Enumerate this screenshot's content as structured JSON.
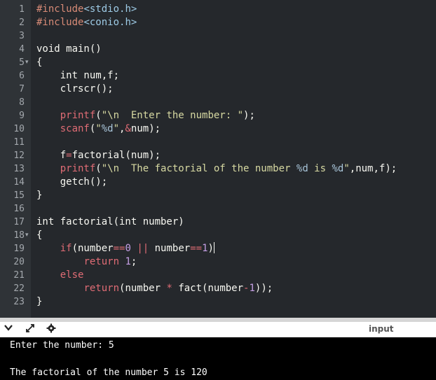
{
  "editor": {
    "lines": [
      {
        "n": "1",
        "fold": "",
        "t": [
          [
            "pp",
            "#include"
          ],
          [
            "hdr",
            "<stdio.h>"
          ]
        ]
      },
      {
        "n": "2",
        "fold": "",
        "t": [
          [
            "pp",
            "#include"
          ],
          [
            "hdr",
            "<conio.h>"
          ]
        ]
      },
      {
        "n": "3",
        "fold": "",
        "t": []
      },
      {
        "n": "4",
        "fold": "",
        "t": [
          [
            "kw",
            "void main()"
          ]
        ]
      },
      {
        "n": "5",
        "fold": "▾",
        "t": [
          [
            "kw",
            "{"
          ]
        ]
      },
      {
        "n": "6",
        "fold": "",
        "t": [
          [
            "kw",
            "    int num,f;"
          ]
        ]
      },
      {
        "n": "7",
        "fold": "",
        "t": [
          [
            "kw",
            "    clrscr();"
          ]
        ]
      },
      {
        "n": "8",
        "fold": "",
        "t": []
      },
      {
        "n": "9",
        "fold": "",
        "t": [
          [
            "kw",
            "    "
          ],
          [
            "fn",
            "printf"
          ],
          [
            "kw",
            "("
          ],
          [
            "str",
            "\"\\n  Enter the number: \""
          ],
          [
            "kw",
            ");"
          ]
        ]
      },
      {
        "n": "10",
        "fold": "",
        "t": [
          [
            "kw",
            "    "
          ],
          [
            "fn",
            "scanf"
          ],
          [
            "kw",
            "("
          ],
          [
            "str",
            "\""
          ],
          [
            "fmt",
            "%d"
          ],
          [
            "str",
            "\""
          ],
          [
            "kw",
            ","
          ],
          [
            "op",
            "&"
          ],
          [
            "kw",
            "num);"
          ]
        ]
      },
      {
        "n": "11",
        "fold": "",
        "t": []
      },
      {
        "n": "12",
        "fold": "",
        "t": [
          [
            "kw",
            "    f"
          ],
          [
            "op",
            "="
          ],
          [
            "kw",
            "factorial(num);"
          ]
        ]
      },
      {
        "n": "13",
        "fold": "",
        "t": [
          [
            "kw",
            "    "
          ],
          [
            "fn",
            "printf"
          ],
          [
            "kw",
            "("
          ],
          [
            "str",
            "\"\\n  The factorial of the number "
          ],
          [
            "fmt",
            "%d"
          ],
          [
            "str",
            " is "
          ],
          [
            "fmt",
            "%d"
          ],
          [
            "str",
            "\""
          ],
          [
            "kw",
            ",num,f);"
          ]
        ]
      },
      {
        "n": "14",
        "fold": "",
        "t": [
          [
            "kw",
            "    getch();"
          ]
        ]
      },
      {
        "n": "15",
        "fold": "",
        "t": [
          [
            "kw",
            "}"
          ]
        ]
      },
      {
        "n": "16",
        "fold": "",
        "t": []
      },
      {
        "n": "17",
        "fold": "",
        "t": [
          [
            "kw",
            "int factorial(int number)"
          ]
        ]
      },
      {
        "n": "18",
        "fold": "▾",
        "t": [
          [
            "kw",
            "{"
          ]
        ]
      },
      {
        "n": "19",
        "fold": "",
        "t": [
          [
            "kw",
            "    "
          ],
          [
            "ret",
            "if"
          ],
          [
            "kw",
            "(number"
          ],
          [
            "op",
            "=="
          ],
          [
            "num",
            "0"
          ],
          [
            "kw",
            " "
          ],
          [
            "op",
            "||"
          ],
          [
            "kw",
            " number"
          ],
          [
            "op",
            "=="
          ],
          [
            "num",
            "1"
          ],
          [
            "kw",
            ")"
          ],
          [
            "cursor",
            ""
          ]
        ]
      },
      {
        "n": "20",
        "fold": "",
        "t": [
          [
            "kw",
            "        "
          ],
          [
            "ret",
            "return"
          ],
          [
            "kw",
            " "
          ],
          [
            "num",
            "1"
          ],
          [
            "kw",
            ";"
          ]
        ]
      },
      {
        "n": "21",
        "fold": "",
        "t": [
          [
            "kw",
            "    "
          ],
          [
            "ret",
            "else"
          ]
        ]
      },
      {
        "n": "22",
        "fold": "",
        "t": [
          [
            "kw",
            "        "
          ],
          [
            "ret",
            "return"
          ],
          [
            "kw",
            "(number "
          ],
          [
            "op",
            "*"
          ],
          [
            "kw",
            " fact(number"
          ],
          [
            "op",
            "-"
          ],
          [
            "num",
            "1"
          ],
          [
            "kw",
            "));"
          ]
        ]
      },
      {
        "n": "23",
        "fold": "",
        "t": [
          [
            "kw",
            "}"
          ]
        ]
      }
    ]
  },
  "toolbar": {
    "icons": [
      "chevron-down-icon",
      "expand-icon",
      "settings-icon"
    ],
    "input_tab_label": "input"
  },
  "terminal": {
    "lines": [
      "Enter the number: 5",
      "",
      "The factorial of the number 5 is 120"
    ]
  }
}
